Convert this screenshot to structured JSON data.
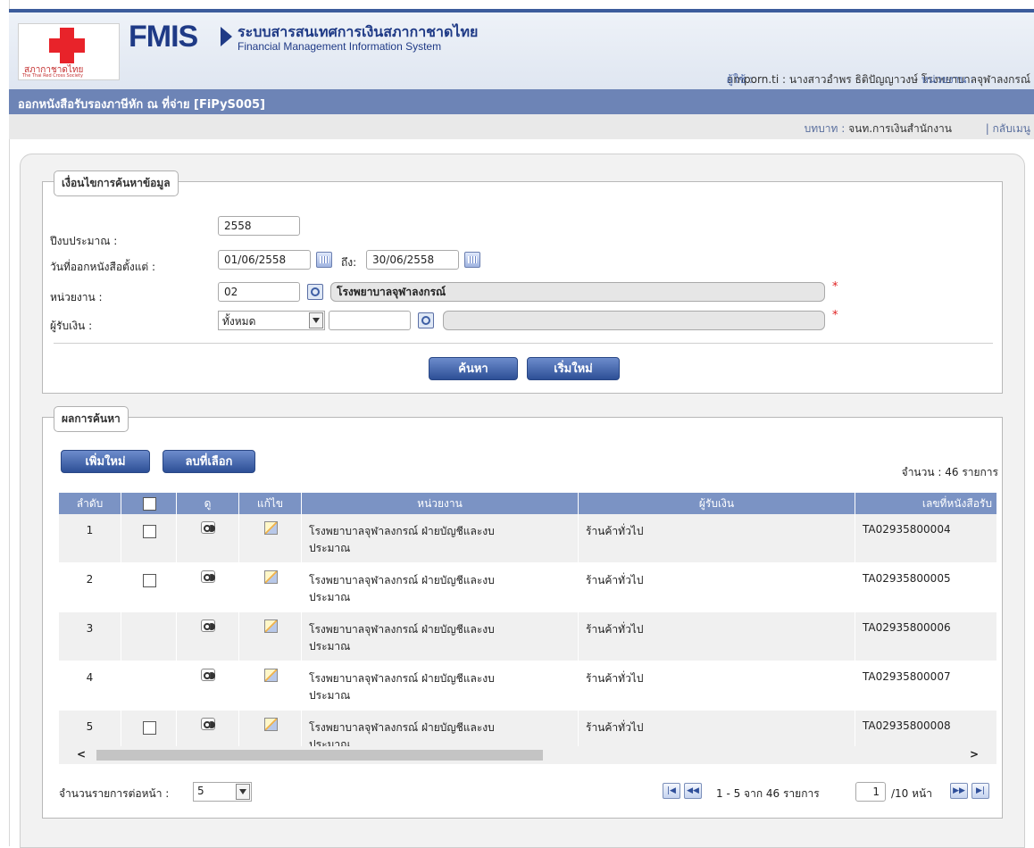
{
  "header": {
    "logo_text": "สภากาชาดไทย",
    "logo_sub": "The Thai Red Cross Society",
    "brand": "FMIS",
    "system_th": "ระบบสารสนเทศการเงินสภากาชาดไทย",
    "system_en": "Financial Management Information System",
    "user_label": "ผู้ใช้ :",
    "user_value": "amporn.ti : นางสาวอำพร ธิติปัญญาวงษ์",
    "unit_label": "หน่วยงาน :",
    "unit_value": "โรงพยาบาลจุฬาลงกรณ์"
  },
  "page_title": "ออกหนังสือรับรองภาษีหัก ณ ที่จ่าย [FiPyS005]",
  "role": {
    "label": "บทบาท :",
    "value": "จนท.การเงินสำนักงาน",
    "back": "| กลับเมนู"
  },
  "search": {
    "legend": "เงื่อนไขการค้นหาข้อมูล",
    "fiscal_year_label": "ปีงบประมาณ :",
    "fiscal_year": "2558",
    "date_from_label": "วันที่ออกหนังสือตั้งแต่ :",
    "date_from": "01/06/2558",
    "date_to_label": "ถึง:",
    "date_to": "30/06/2558",
    "unit_label": "หน่วยงาน :",
    "unit_code": "02",
    "unit_name": "โรงพยาบาลจุฬาลงกรณ์",
    "payee_label": "ผู้รับเงิน :",
    "payee_type": "ทั้งหมด",
    "payee_code": "",
    "payee_name": "",
    "required_mark": "*",
    "search_button": "ค้นหา",
    "reset_button": "เริ่มใหม่"
  },
  "results": {
    "legend": "ผลการค้นหา",
    "add_button": "เพิ่มใหม่",
    "delete_button": "ลบที่เลือก",
    "count_text": "จำนวน : 46 รายการ",
    "columns": [
      "ลำดับ",
      "",
      "ดู",
      "แก้ไข",
      "หน่วยงาน",
      "ผู้รับเงิน",
      "เลขที่หนังสือรับ"
    ],
    "rows": [
      {
        "no": "1",
        "checkbox": true,
        "unit": "โรงพยาบาลจุฬาลงกรณ์ ฝ่ายบัญชีและงบ",
        "unit2": "ประมาณ",
        "payee": "ร้านค้าทั่วไป",
        "doc": "TA02935800004"
      },
      {
        "no": "2",
        "checkbox": true,
        "unit": "โรงพยาบาลจุฬาลงกรณ์ ฝ่ายบัญชีและงบ",
        "unit2": "ประมาณ",
        "payee": "ร้านค้าทั่วไป",
        "doc": "TA02935800005"
      },
      {
        "no": "3",
        "checkbox": false,
        "unit": "โรงพยาบาลจุฬาลงกรณ์ ฝ่ายบัญชีและงบ",
        "unit2": "ประมาณ",
        "payee": "ร้านค้าทั่วไป",
        "doc": "TA02935800006"
      },
      {
        "no": "4",
        "checkbox": false,
        "unit": "โรงพยาบาลจุฬาลงกรณ์ ฝ่ายบัญชีและงบ",
        "unit2": "ประมาณ",
        "payee": "ร้านค้าทั่วไป",
        "doc": "TA02935800007"
      },
      {
        "no": "5",
        "checkbox": true,
        "unit": "โรงพยาบาลจุฬาลงกรณ์ ฝ่ายบัญชีและงบ",
        "unit2": "ประมาณ",
        "payee": "ร้านค้าทั่วไป",
        "doc": "TA02935800008"
      }
    ]
  },
  "pagination": {
    "per_page_label": "จำนวนรายการต่อหน้า :",
    "per_page": "5",
    "range_text": "1 - 5 จาก 46 รายการ",
    "page": "1",
    "of_pages": "/10 หน้า"
  },
  "colors": {
    "header_bar": "#6d84b6",
    "grid_header": "#7b93c4",
    "button": "#3a5ba3",
    "brand": "#1f3a86",
    "required": "#e02020"
  }
}
